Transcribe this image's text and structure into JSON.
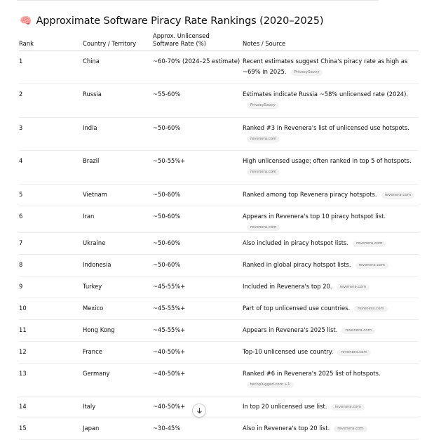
{
  "title": {
    "emoji": "🧠",
    "text": "Approximate Software Piracy Rate Rankings (2020–2025)"
  },
  "headers": {
    "rank": "Rank",
    "country": "Country / Territory",
    "rate_line1": "Approx. Unlicensed",
    "rate_line2": "Software Rate (%)",
    "notes": "Notes / Source"
  },
  "rows": [
    {
      "rank": "1",
      "country": "China",
      "rate": "~60-70% (2024–25 estimate)",
      "note": "Recent estimates suggest China's piracy rate as high as ~69% in 2025.",
      "source": "PrivacySavvy"
    },
    {
      "rank": "2",
      "country": "Russia",
      "rate": "~55-60%",
      "note": "Estimates indicate Russia ~58% unlicensed rate (2024).",
      "source": "PrivacySavvy"
    },
    {
      "rank": "3",
      "country": "India",
      "rate": "~50-60%",
      "note": "Ranked #3 in Revenera's list of unlicensed use hotspots.",
      "source": "revenera.com"
    },
    {
      "rank": "4",
      "country": "Brazil",
      "rate": "~50-55%+",
      "note": "High unlicensed usage; often ranked in top 5 of hotspots.",
      "source": "revenera.com"
    },
    {
      "rank": "5",
      "country": "Vietnam",
      "rate": "~50-60%",
      "note": "Ranked among top Revenera piracy hotspots.",
      "source": "revenera.com"
    },
    {
      "rank": "6",
      "country": "Iran",
      "rate": "~50-60%",
      "note": "Appears in Revenera's top 10 piracy hotspot list.",
      "source": "revenera.com"
    },
    {
      "rank": "7",
      "country": "Ukraine",
      "rate": "~50-60%",
      "note": "Also included in piracy hotspot lists.",
      "source": "revenera.com"
    },
    {
      "rank": "8",
      "country": "Indonesia",
      "rate": "~50-60%",
      "note": "Ranked in global piracy hotspot lists.",
      "source": "revenera.com"
    },
    {
      "rank": "9",
      "country": "Turkey",
      "rate": "~45-55%+",
      "note": "Included in Revenera's top 20.",
      "source": "revenera.com"
    },
    {
      "rank": "10",
      "country": "Mexico",
      "rate": "~45-55%+",
      "note": "Part of top unlicensed use countries.",
      "source": "revenera.com"
    },
    {
      "rank": "11",
      "country": "Hong Kong",
      "rate": "~45-55%+",
      "note": "Appears in Revenera's 2025 list.",
      "source": "revenera.com"
    },
    {
      "rank": "12",
      "country": "France",
      "rate": "~40-50%+",
      "note": "Top-10 unlicensed use country.",
      "source": "revenera.com"
    },
    {
      "rank": "13",
      "country": "Germany",
      "rate": "~40-50%+",
      "note": "Ranked #6 in Revenera's 2025 list of hotspots.",
      "source": "techplugged.com +1"
    },
    {
      "rank": "14",
      "country": "Italy",
      "rate": "~40-50%+",
      "note": "In top 20 unlicensed use list.",
      "source": "revenera.com"
    },
    {
      "rank": "15",
      "country": "Japan",
      "rate": "~30-45%",
      "note": "Also in Revenera's top 20 list.",
      "source": "revenera.com"
    }
  ],
  "scroll_icon": "arrow-down-icon"
}
